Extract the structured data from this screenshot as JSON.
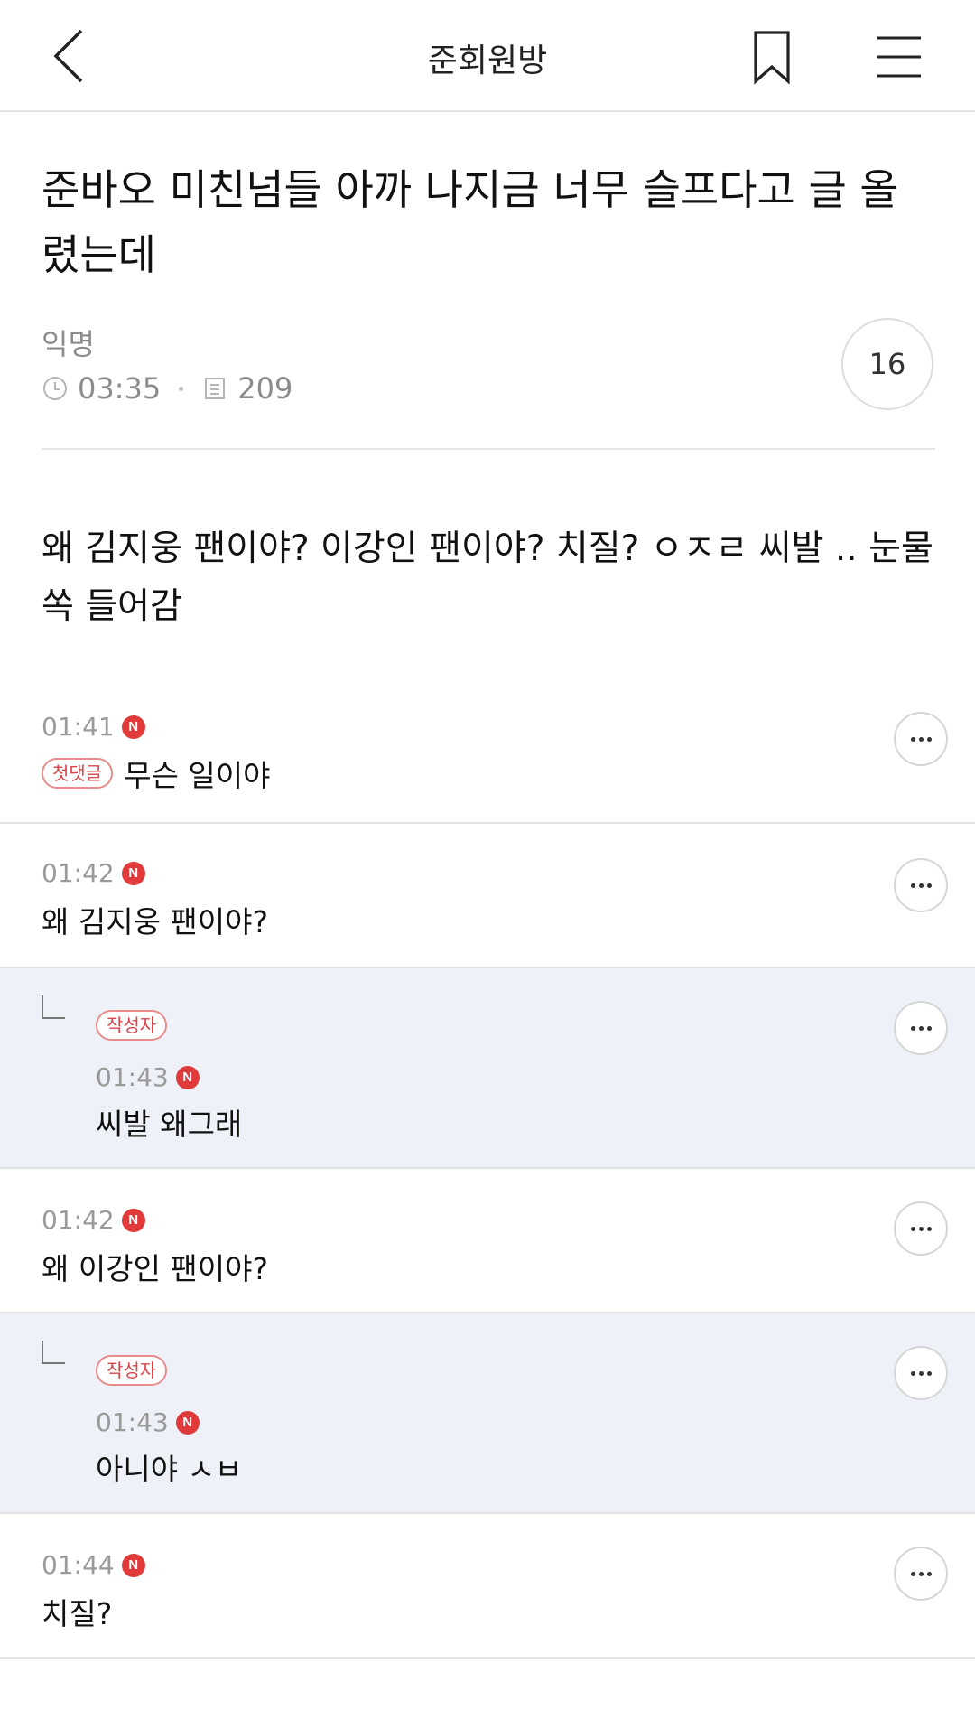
{
  "header": {
    "title": "준회원방"
  },
  "post": {
    "title": "준바오 미친넘들 아까 나지금 너무 슬프다고 글 올렸는데",
    "author": "익명",
    "time": "03:35",
    "views": "209",
    "comment_count": "16",
    "body": "왜 김지웅 팬이야? 이강인 팬이야? 치질? ㅇㅈㄹ 씨발 .. 눈물 쏙 들어감"
  },
  "comments": [
    {
      "time": "01:41",
      "badge": "N",
      "tag": "첫댓글",
      "text": "무슨 일이야"
    },
    {
      "time": "01:42",
      "badge": "N",
      "text": "왜 김지웅 팬이야?"
    },
    {
      "time": "01:43",
      "badge": "N",
      "tag": "작성자",
      "text": "씨발 왜그래"
    },
    {
      "time": "01:42",
      "badge": "N",
      "text": "왜 이강인 팬이야?"
    },
    {
      "time": "01:43",
      "badge": "N",
      "tag": "작성자",
      "text": "아니야 ㅅㅂ"
    },
    {
      "time": "01:44",
      "badge": "N",
      "text": "치질?"
    }
  ]
}
